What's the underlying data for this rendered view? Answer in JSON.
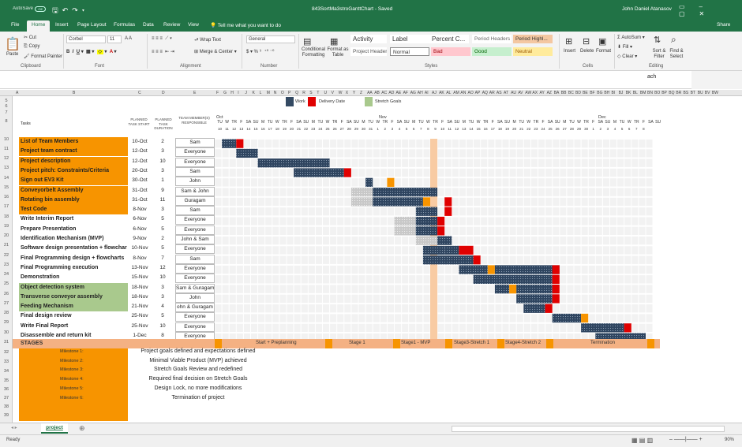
{
  "titlebar": {
    "autosave_label": "AutoSave",
    "autosave_state": "Off",
    "title": "843SortMa3stroGanttChart - Saved",
    "user": "John Daniel Atanasov"
  },
  "tabs": [
    "File",
    "Home",
    "Insert",
    "Page Layout",
    "Formulas",
    "Data",
    "Review",
    "View"
  ],
  "active_tab": "Home",
  "tell_me": "Tell me what you want to do",
  "share": "Share",
  "ribbon": {
    "clipboard": {
      "paste": "Paste",
      "cut": "Cut",
      "copy": "Copy",
      "format_painter": "Format Painter",
      "label": "Clipboard"
    },
    "font": {
      "name": "Corbel",
      "size": "11",
      "label": "Font"
    },
    "alignment": {
      "wrap": "Wrap Text",
      "merge": "Merge & Center",
      "label": "Alignment"
    },
    "number": {
      "format": "General",
      "label": "Number"
    },
    "styles": {
      "conditional": "Conditional Formatting",
      "format_table": "Format as Table",
      "cells": [
        {
          "text": "Activity",
          "bg": "#ffffff",
          "fg": "#333333"
        },
        {
          "text": "Label",
          "bg": "#ffffff",
          "fg": "#333333"
        },
        {
          "text": "Percent C...",
          "bg": "#ffffff",
          "fg": "#333333"
        },
        {
          "text": "Period Headers",
          "bg": "#ffffff",
          "fg": "#666666"
        },
        {
          "text": "Period Highl...",
          "bg": "#f4c7a1",
          "fg": "#333333"
        },
        {
          "text": "Project Headers",
          "bg": "#ffffff",
          "fg": "#555555"
        },
        {
          "text": "Normal",
          "bg": "#ffffff",
          "fg": "#333333"
        },
        {
          "text": "Bad",
          "bg": "#ffc7ce",
          "fg": "#9c0006"
        },
        {
          "text": "Good",
          "bg": "#c6efce",
          "fg": "#006100"
        },
        {
          "text": "Neutral",
          "bg": "#ffeb9c",
          "fg": "#9c5700"
        }
      ],
      "label": "Styles"
    },
    "cells_group": {
      "insert": "Insert",
      "delete": "Delete",
      "format": "Format",
      "label": "Cells"
    },
    "editing": {
      "autosum": "AutoSum",
      "fill": "Fill",
      "clear": "Clear",
      "sort": "Sort & Filter",
      "find": "Find & Select",
      "label": "Editing"
    }
  },
  "formula_bar_text": "ach",
  "legend": [
    {
      "label": "Work",
      "color": "#344a63"
    },
    {
      "label": "Delivery Date",
      "color": "#e00000"
    },
    {
      "label": "Stretch Goals",
      "color": "#a9c98d"
    }
  ],
  "headers": {
    "tasks": "Tasks",
    "start": "PLANNED TASK START",
    "duration": "PLANNED TASK DURATION",
    "members": "TEAM MEMBER(S) RESPONSIBLE"
  },
  "months": [
    "Oct",
    "Nov",
    "Dec"
  ],
  "tasks": [
    {
      "name": "List of Team Members",
      "start": "10-Oct",
      "dur": "2",
      "member": "Sam",
      "color": "#f79400"
    },
    {
      "name": "Project team contract",
      "start": "12-Oct",
      "dur": "3",
      "member": "Everyone",
      "color": "#f79400"
    },
    {
      "name": "Project description",
      "start": "12-Oct",
      "dur": "10",
      "member": "Everyone",
      "color": "#f79400"
    },
    {
      "name": "Project pitch: Constraints/Criteria",
      "start": "20-Oct",
      "dur": "3",
      "member": "Sam",
      "color": "#f79400"
    },
    {
      "name": "Sign out EV3 Kit",
      "start": "30-Oct",
      "dur": "1",
      "member": "John",
      "color": "#f79400"
    },
    {
      "name": "Conveyorbelt Assembly",
      "start": "31-Oct",
      "dur": "9",
      "member": "Sam & John",
      "color": "#f79400"
    },
    {
      "name": "Rotating bin assembly",
      "start": "31-Oct",
      "dur": "11",
      "member": "Guragam",
      "color": "#f79400"
    },
    {
      "name": "Test Code",
      "start": "8-Nov",
      "dur": "3",
      "member": "Sam",
      "color": "#f79400"
    },
    {
      "name": "Write Interim Report",
      "start": "6-Nov",
      "dur": "5",
      "member": "Everyone",
      "color": ""
    },
    {
      "name": "Prepare Presentation",
      "start": "6-Nov",
      "dur": "5",
      "member": "Everyone",
      "color": ""
    },
    {
      "name": "Identification Mechanism (MVP)",
      "start": "9-Nov",
      "dur": "2",
      "member": "John & Sam",
      "color": ""
    },
    {
      "name": "Software design presentation + flowchar",
      "start": "10-Nov",
      "dur": "5",
      "member": "Everyone",
      "color": ""
    },
    {
      "name": "Final Programming design + flowcharts",
      "start": "8-Nov",
      "dur": "7",
      "member": "Sam",
      "color": ""
    },
    {
      "name": "Final Programming execution",
      "start": "13-Nov",
      "dur": "12",
      "member": "Everyone",
      "color": ""
    },
    {
      "name": "Demonstration",
      "start": "15-Nov",
      "dur": "10",
      "member": "Everyone",
      "color": ""
    },
    {
      "name": "Object detection system",
      "start": "18-Nov",
      "dur": "3",
      "member": "Sam & Guragam",
      "color": "#a9c98d"
    },
    {
      "name": "Transverse conveyor assembly",
      "start": "18-Nov",
      "dur": "3",
      "member": "John",
      "color": "#a9c98d"
    },
    {
      "name": "Feeding Mechanism",
      "start": "21-Nov",
      "dur": "4",
      "member": "ohn & Guragam",
      "color": "#a9c98d"
    },
    {
      "name": "Final design review",
      "start": "25-Nov",
      "dur": "5",
      "member": "Everyone",
      "color": ""
    },
    {
      "name": "Write Final Report",
      "start": "25-Nov",
      "dur": "10",
      "member": "Everyone",
      "color": ""
    },
    {
      "name": "Disassemble and return kit",
      "start": "1-Dec",
      "dur": "8",
      "member": "Everyone",
      "color": ""
    }
  ],
  "stages_label": "STAGES",
  "stages": [
    {
      "name": "Start + Preplanning",
      "offset": 52
    },
    {
      "name": "Stage 1",
      "offset": 170
    },
    {
      "name": "Stage1 - MVP",
      "offset": 236
    },
    {
      "name": "Stage3-Stretch 1",
      "offset": 303
    },
    {
      "name": "Stage4-Stretch 2",
      "offset": 368
    },
    {
      "name": "Termination",
      "offset": 476
    }
  ],
  "milestones": [
    {
      "label": "Milestone 1:",
      "text": "Project goals defined and expectations defined"
    },
    {
      "label": "Milestone 2:",
      "text": "Minimal Viable Product (MVP) achieved"
    },
    {
      "label": "Milestone 3:",
      "text": "Stretch Goals Review and redefined"
    },
    {
      "label": "Milestone 4:",
      "text": "Required final decision on Stretch Goals"
    },
    {
      "label": "Milestone 5:",
      "text": "Design Lock, no more modifications"
    },
    {
      "label": "Milestone 6:",
      "text": "Termination of project"
    }
  ],
  "sheet_tab": "project",
  "status": {
    "ready": "Ready",
    "zoom": "90%"
  },
  "days": [
    "TU",
    "W",
    "TR",
    "F",
    "SA",
    "SU",
    "M",
    "TU",
    "W",
    "TR",
    "F",
    "SA",
    "SU",
    "M",
    "TU",
    "W",
    "TR",
    "F",
    "SA",
    "SU",
    "M",
    "TU",
    "W",
    "TR",
    "F",
    "SA",
    "SU",
    "M",
    "TU",
    "W",
    "TR",
    "F",
    "SA",
    "SU",
    "M",
    "TU",
    "W",
    "TR",
    "F",
    "SA",
    "SU",
    "M",
    "TU",
    "W",
    "TR",
    "F",
    "SA",
    "SU",
    "M",
    "TU",
    "W",
    "TR",
    "F",
    "SA",
    "SU",
    "M",
    "TU",
    "W",
    "TR",
    "F",
    "SA",
    "SU",
    "M"
  ],
  "dates": [
    "10",
    "11",
    "12",
    "13",
    "14",
    "15",
    "16",
    "17",
    "18",
    "19",
    "20",
    "21",
    "22",
    "23",
    "24",
    "25",
    "26",
    "27",
    "28",
    "29",
    "30",
    "31",
    "1",
    "2",
    "3",
    "4",
    "5",
    "6",
    "7",
    "8",
    "9",
    "10",
    "11",
    "12",
    "13",
    "14",
    "15",
    "16",
    "17",
    "18",
    "19",
    "20",
    "21",
    "22",
    "23",
    "24",
    "25",
    "26",
    "27",
    "28",
    "29",
    "30",
    "1",
    "2",
    "3",
    "4",
    "5",
    "6",
    "7",
    "8"
  ]
}
